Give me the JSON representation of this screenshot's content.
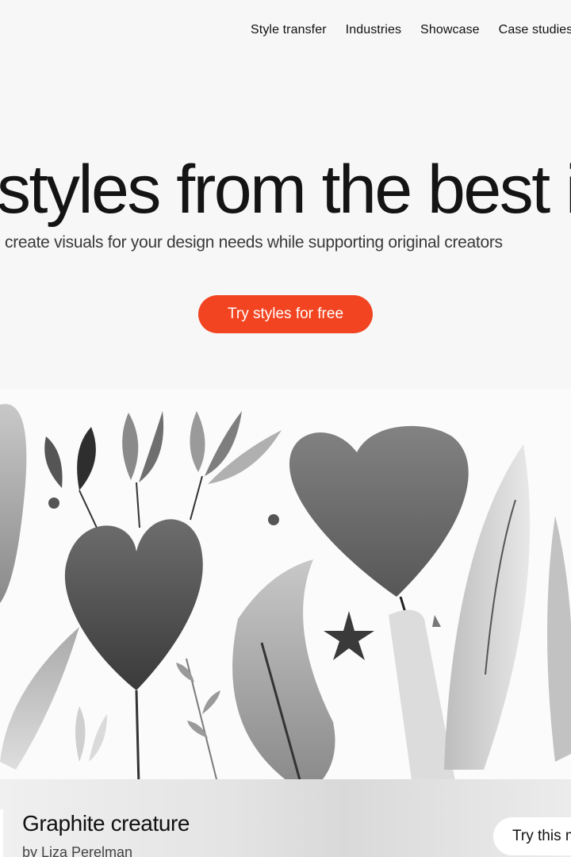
{
  "nav": {
    "items": [
      {
        "label": "Style transfer"
      },
      {
        "label": "Industries"
      },
      {
        "label": "Showcase"
      },
      {
        "label": "Case studies"
      }
    ]
  },
  "hero": {
    "headline": "styles from the best illustrators",
    "subheadline": "create visuals for your design needs while supporting original creators",
    "cta_label": "Try styles for free"
  },
  "style_card": {
    "title": "Graphite creature",
    "author": "by Liza Perelman",
    "button_label": "Try this mood"
  }
}
